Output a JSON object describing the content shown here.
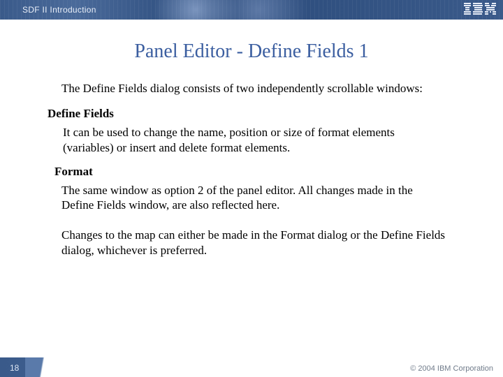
{
  "header": {
    "title": "SDF II  Introduction",
    "logo_name": "ibm-logo"
  },
  "slide": {
    "title": "Panel Editor - Define Fields 1",
    "intro": "The Define Fields dialog consists of two independently scrollable windows:",
    "sections": [
      {
        "heading": "Define Fields",
        "body": "It can be used to change the name, position or size of format elements (variables) or insert and delete format elements."
      },
      {
        "heading": "Format",
        "body": "The same window as option 2 of the panel editor. All changes made in the Define Fields window, are also reflected here."
      }
    ],
    "closing": "Changes to the map can either be made in the Format dialog or the Define Fields dialog, whichever is preferred."
  },
  "footer": {
    "page": "18",
    "copyright": "© 2004 IBM Corporation"
  }
}
